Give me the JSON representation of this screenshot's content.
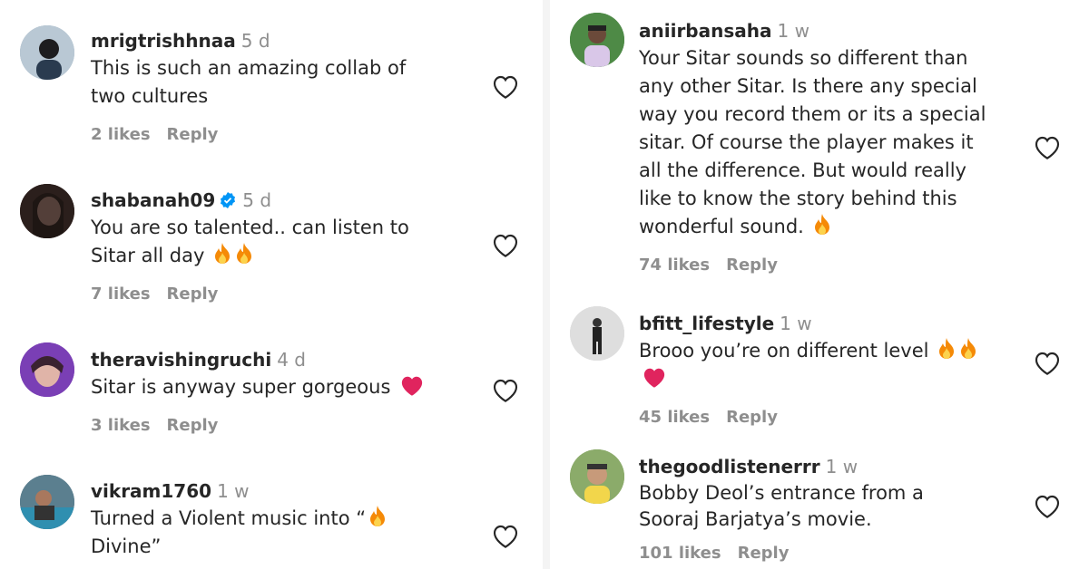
{
  "left_comments": [
    {
      "username": "mrigtrishhnaa",
      "time": "5 d",
      "verified": false,
      "lines": [
        "This is such an amazing collab of",
        "two cultures"
      ],
      "emoji": [],
      "likes": "2 likes",
      "reply": "Reply",
      "avatar_color": "#8fa6b8"
    },
    {
      "username": "shabanah09",
      "time": "5 d",
      "verified": true,
      "lines": [
        "You are so talented.. can listen to",
        "Sitar all day"
      ],
      "emoji": [
        "fire-emoji",
        "fire-emoji"
      ],
      "likes": "7 likes",
      "reply": "Reply",
      "avatar_color": "#3a2a26"
    },
    {
      "username": "theravishingruchi",
      "time": "4 d",
      "verified": false,
      "lines": [
        "Sitar is anyway super gorgeous"
      ],
      "emoji": [
        "red-heart-emoji"
      ],
      "likes": "3 likes",
      "reply": "Reply",
      "avatar_color": "#7a3fb5"
    },
    {
      "username": "vikram1760",
      "time": "1 w",
      "verified": false,
      "lines": [
        "Turned a Violent music into “",
        "Divine”"
      ],
      "emoji": [
        "fire-emoji"
      ],
      "likes": "",
      "reply": "",
      "avatar_color": "#4b6a7a"
    }
  ],
  "right_comments": [
    {
      "username": "aniirbansaha",
      "time": "1 w",
      "verified": false,
      "lines": [
        "Your Sitar sounds so different than",
        "any other Sitar. Is there any special",
        "way you record them or its a special",
        "sitar. Of course the player makes it",
        "all the difference. But would really",
        "like to know the story behind this",
        "wonderful sound."
      ],
      "emoji": [
        "fire-emoji"
      ],
      "likes": "74 likes",
      "reply": "Reply",
      "avatar_color": "#3f7a3a"
    },
    {
      "username": "bfitt_lifestyle",
      "time": "1 w",
      "verified": false,
      "lines": [
        "Brooo you’re on different level",
        ""
      ],
      "emoji": [
        "fire-emoji",
        "fire-emoji",
        "red-heart-emoji"
      ],
      "likes": "45 likes",
      "reply": "Reply",
      "avatar_color": "#d8d8d8"
    },
    {
      "username": "thegoodlistenerrr",
      "time": "1 w",
      "verified": false,
      "lines": [
        "Bobby Deol’s entrance from a",
        "Sooraj Barjatya’s movie."
      ],
      "emoji": [],
      "likes": "101 likes",
      "reply": "Reply",
      "avatar_color": "#7a9a5a"
    }
  ],
  "colors": {
    "text": "#262626",
    "muted": "#8e8e8e",
    "verified": "#0095f6",
    "heart_emoji": "#e0245e",
    "fire": "#f58a07"
  }
}
